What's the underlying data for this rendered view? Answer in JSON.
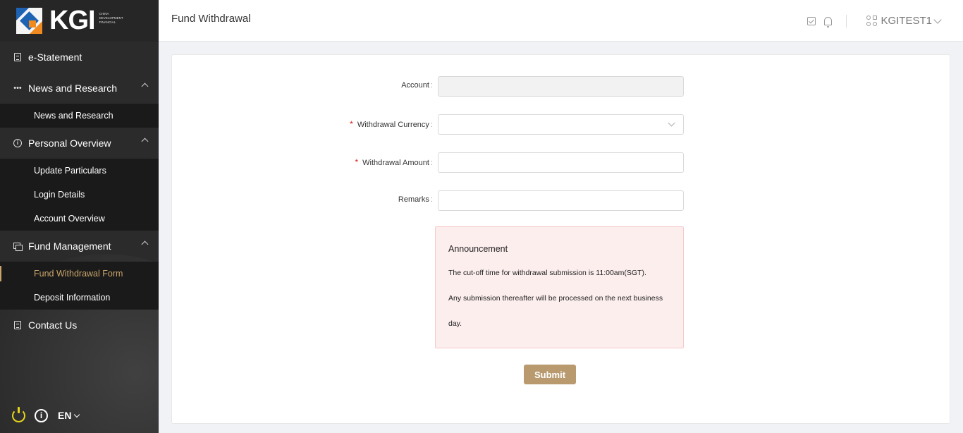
{
  "brand": {
    "logo_text": "KGI",
    "logo_subtext": "CHINA DEVELOPMENT FINANCIAL"
  },
  "sidebar": {
    "items": [
      {
        "label": "e-Statement",
        "icon": "document-icon"
      },
      {
        "label": "News and Research",
        "icon": "dots-icon",
        "expanded": true,
        "children": [
          {
            "label": "News and Research"
          }
        ]
      },
      {
        "label": "Personal Overview",
        "icon": "info-icon",
        "expanded": true,
        "children": [
          {
            "label": "Update Particulars"
          },
          {
            "label": "Login Details"
          },
          {
            "label": "Account Overview"
          }
        ]
      },
      {
        "label": "Fund Management",
        "icon": "money-icon",
        "expanded": true,
        "children": [
          {
            "label": "Fund Withdrawal Form",
            "active": true
          },
          {
            "label": "Deposit Information"
          }
        ]
      },
      {
        "label": "Contact Us",
        "icon": "document-icon"
      }
    ],
    "footer": {
      "language": "EN"
    }
  },
  "header": {
    "title": "Fund Withdrawal",
    "username": "KGITEST1"
  },
  "form": {
    "account": {
      "label": "Account",
      "value": ""
    },
    "currency": {
      "label": "Withdrawal Currency",
      "value": "",
      "required": true
    },
    "amount": {
      "label": "Withdrawal Amount",
      "value": "",
      "required": true
    },
    "remarks": {
      "label": "Remarks",
      "value": ""
    },
    "colon": ":",
    "required_mark": "*"
  },
  "announcement": {
    "title": "Announcement",
    "line1": "The cut-off time for withdrawal submission is 11:00am(SGT).",
    "line2": "Any submission thereafter will be processed on the next business",
    "line3": "day."
  },
  "submit_label": "Submit",
  "colors": {
    "accent": "#c9a46b",
    "button": "#b89a6e",
    "sidebar_bg": "#2b2b2b",
    "announcement_bg": "#fdeeee",
    "power": "#e8d51c"
  }
}
